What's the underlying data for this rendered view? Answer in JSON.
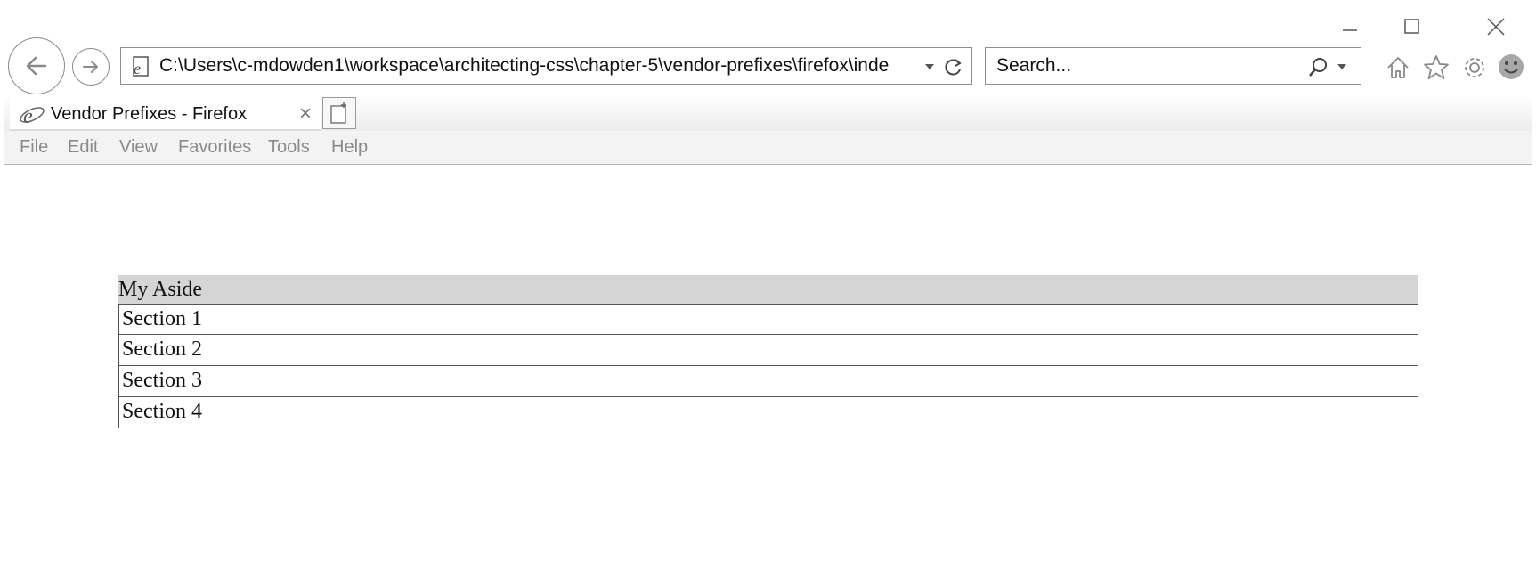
{
  "window": {
    "caption": {
      "minimize_icon": "minimize-icon",
      "maximize_icon": "maximize-icon",
      "close_icon": "close-icon"
    }
  },
  "toolbar": {
    "address": "C:\\Users\\c-mdowden1\\workspace\\architecting-css\\chapter-5\\vendor-prefixes\\firefox\\inde",
    "search_placeholder": "Search...",
    "icons": [
      "back-icon",
      "forward-icon",
      "page-icon",
      "dropdown-icon",
      "refresh-icon",
      "search-icon",
      "home-icon",
      "favorites-star-icon",
      "settings-gear-icon",
      "feedback-smiley-icon"
    ]
  },
  "tab": {
    "title": "Vendor Prefixes - Firefox",
    "close_glyph": "×"
  },
  "menu": {
    "items": [
      "File",
      "Edit",
      "View",
      "Favorites",
      "Tools",
      "Help"
    ]
  },
  "page": {
    "aside_heading": "My Aside",
    "sections": [
      "Section 1",
      "Section 2",
      "Section 3",
      "Section 4"
    ]
  },
  "colors": {
    "aside_bg": "#d5d5d5",
    "menu_text": "#8a8a8a",
    "border": "#555555"
  }
}
